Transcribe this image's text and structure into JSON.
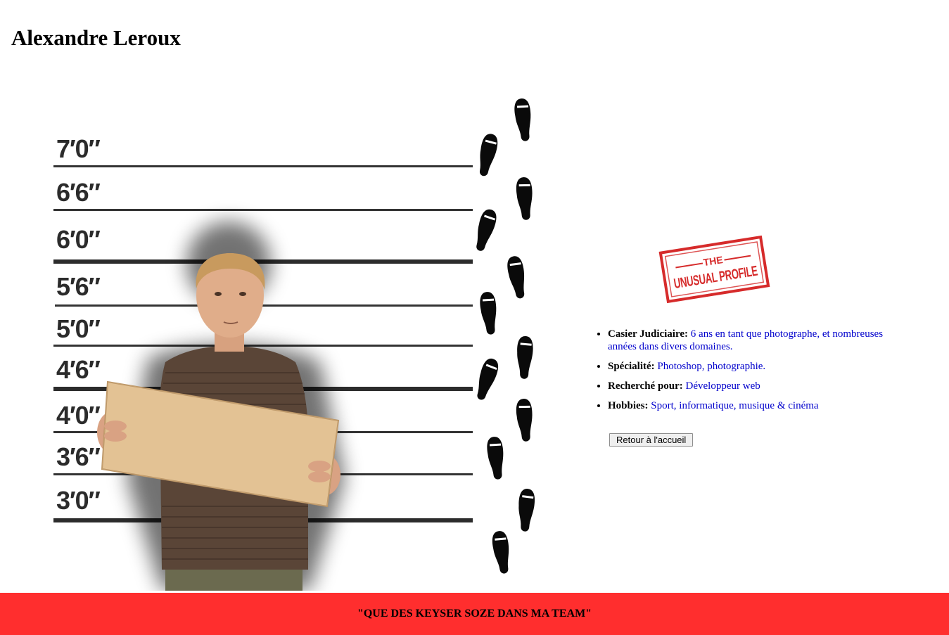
{
  "page": {
    "title": "Alexandre Leroux"
  },
  "lineup": {
    "height_labels": [
      "7′0″",
      "6′6″",
      "6′0″",
      "5′6″",
      "5′0″",
      "4′6″",
      "4′0″",
      "3′6″",
      "3′0″"
    ]
  },
  "stamp": {
    "line1": "THE",
    "line2": "UNUSUAL PROFILE",
    "color": "#d62b2b"
  },
  "profile": {
    "items": [
      {
        "label": "Casier Judiciaire:",
        "value": "6 ans en tant que photographe, et nombreuses années dans divers domaines."
      },
      {
        "label": "Spécialité:",
        "value": "Photoshop, photographie."
      },
      {
        "label": "Recherché pour:",
        "value": "Développeur web"
      },
      {
        "label": "Hobbies:",
        "value": "Sport, informatique, musique & cinéma"
      }
    ]
  },
  "button": {
    "label": "Retour à l'accueil"
  },
  "footer": {
    "quote": "\"QUE DES KEYSER SOZE DANS MA TEAM\"",
    "bg_color": "#ff2e2e"
  }
}
